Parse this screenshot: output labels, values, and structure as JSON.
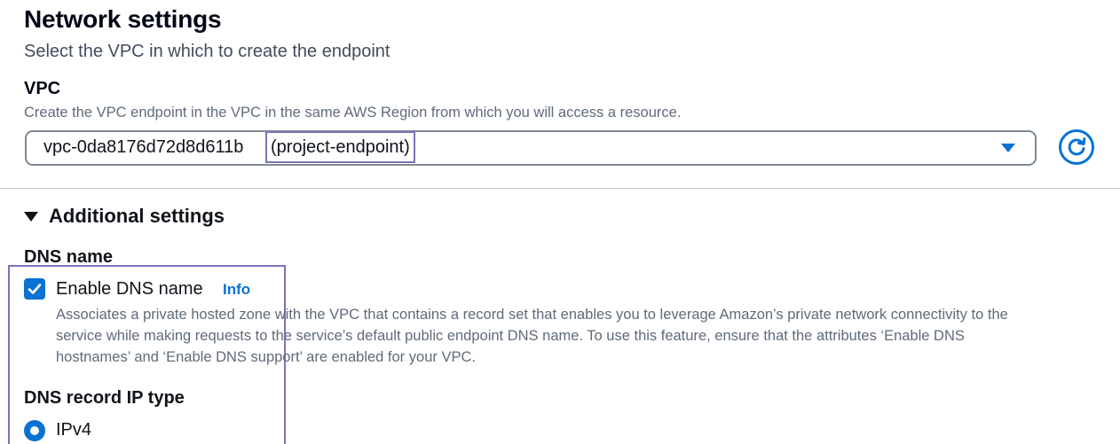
{
  "network": {
    "title": "Network settings",
    "description": "Select the VPC in which to create the endpoint"
  },
  "vpc": {
    "label": "VPC",
    "description": "Create the VPC endpoint in the VPC in the same AWS Region from which you will access a resource.",
    "selected_id": "vpc-0da8176d72d8d611b",
    "selected_name": "(project-endpoint)",
    "refresh_icon": "refresh-icon",
    "dropdown_icon": "caret-down-icon"
  },
  "additional": {
    "label": "Additional settings",
    "expanded": true
  },
  "dns": {
    "section_label": "DNS name",
    "checkbox_label": "Enable DNS name",
    "checked": true,
    "info_link": "Info",
    "description": "Associates a private hosted zone with the VPC that contains a record set that enables you to leverage Amazon’s private network connectivity to the service while making requests to the service’s default public endpoint DNS name. To use this feature, ensure that the attributes ‘Enable DNS hostnames’ and ‘Enable DNS support’ are enabled for your VPC."
  },
  "ip_type": {
    "label": "DNS record IP type",
    "selected_option": "IPv4"
  },
  "colors": {
    "accent": "#0972d3",
    "highlight": "#7b74b8",
    "heading": "#000716",
    "secondary_text": "#5f6b7a"
  }
}
